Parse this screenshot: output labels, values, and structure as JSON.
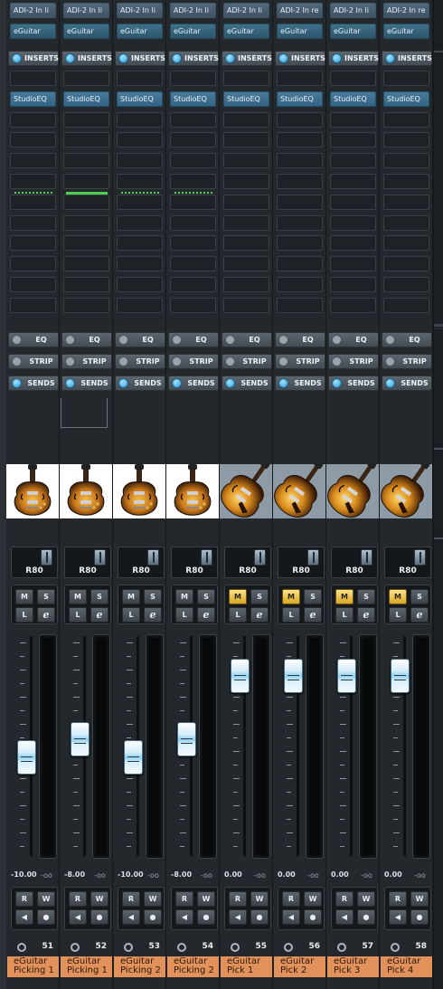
{
  "sections": {
    "inserts_label": "INSERTS",
    "eq_label": "EQ",
    "strip_label": "STRIP",
    "sends_label": "SENDS"
  },
  "channel_setting_label": "R80",
  "buttons": {
    "mute": "M",
    "solo": "S",
    "listen": "L",
    "edit": "e",
    "read": "R",
    "write": "W"
  },
  "colors": {
    "name_tag": "#e3915a",
    "mute_active": "#f1c54d",
    "insert_eq": "#3f6f89",
    "meter_green": "#4cd04c"
  },
  "channels": [
    {
      "input": "ADI-2 In li",
      "output": "eGuitar",
      "insert": "StudioEQ",
      "volume": "-10.00",
      "peak": "-oo",
      "number": "51",
      "name_line1": "eGuitar",
      "name_line2": "Picking 1",
      "mute_active": false,
      "fader_level": 0.45,
      "guitar": "sunburst-semi",
      "meter_style": "dotted"
    },
    {
      "input": "ADI-2 In li",
      "output": "eGuitar",
      "insert": "StudioEQ",
      "volume": "-8.00",
      "peak": "-oo",
      "number": "52",
      "name_line1": "eGuitar",
      "name_line2": "Picking 1",
      "mute_active": false,
      "fader_level": 0.53,
      "guitar": "sunburst-semi",
      "meter_style": "solid"
    },
    {
      "input": "ADI-2 In li",
      "output": "eGuitar",
      "insert": "StudioEQ",
      "volume": "-10.00",
      "peak": "-oo",
      "number": "53",
      "name_line1": "eGuitar",
      "name_line2": "Picking 2",
      "mute_active": false,
      "fader_level": 0.45,
      "guitar": "sunburst-semi",
      "meter_style": "dotted"
    },
    {
      "input": "ADI-2 In li",
      "output": "eGuitar",
      "insert": "StudioEQ",
      "volume": "-8.00",
      "peak": "-oo",
      "number": "54",
      "name_line1": "eGuitar",
      "name_line2": "Picking 2",
      "mute_active": false,
      "fader_level": 0.53,
      "guitar": "sunburst-semi",
      "meter_style": "dotted"
    },
    {
      "input": "ADI-2 In li",
      "output": "eGuitar",
      "insert": "StudioEQ",
      "volume": "0.00",
      "peak": "-oo",
      "number": "55",
      "name_line1": "eGuitar",
      "name_line2": "Pick 1",
      "mute_active": true,
      "fader_level": 0.82,
      "guitar": "sunburst-jazz",
      "meter_style": "none"
    },
    {
      "input": "ADI-2 In re",
      "output": "eGuitar",
      "insert": "StudioEQ",
      "volume": "0.00",
      "peak": "-oo",
      "number": "56",
      "name_line1": "eGuitar",
      "name_line2": "Pick 2",
      "mute_active": true,
      "fader_level": 0.82,
      "guitar": "sunburst-jazz",
      "meter_style": "none"
    },
    {
      "input": "ADI-2 In li",
      "output": "eGuitar",
      "insert": "StudioEQ",
      "volume": "0.00",
      "peak": "-oo",
      "number": "57",
      "name_line1": "eGuitar",
      "name_line2": "Pick 3",
      "mute_active": true,
      "fader_level": 0.82,
      "guitar": "sunburst-jazz",
      "meter_style": "none"
    },
    {
      "input": "ADI-2 In re",
      "output": "eGuitar",
      "insert": "StudioEQ",
      "volume": "0.00",
      "peak": "-oo",
      "number": "58",
      "name_line1": "eGuitar",
      "name_line2": "Pick 4",
      "mute_active": true,
      "fader_level": 0.82,
      "guitar": "sunburst-jazz",
      "meter_style": "none"
    }
  ]
}
